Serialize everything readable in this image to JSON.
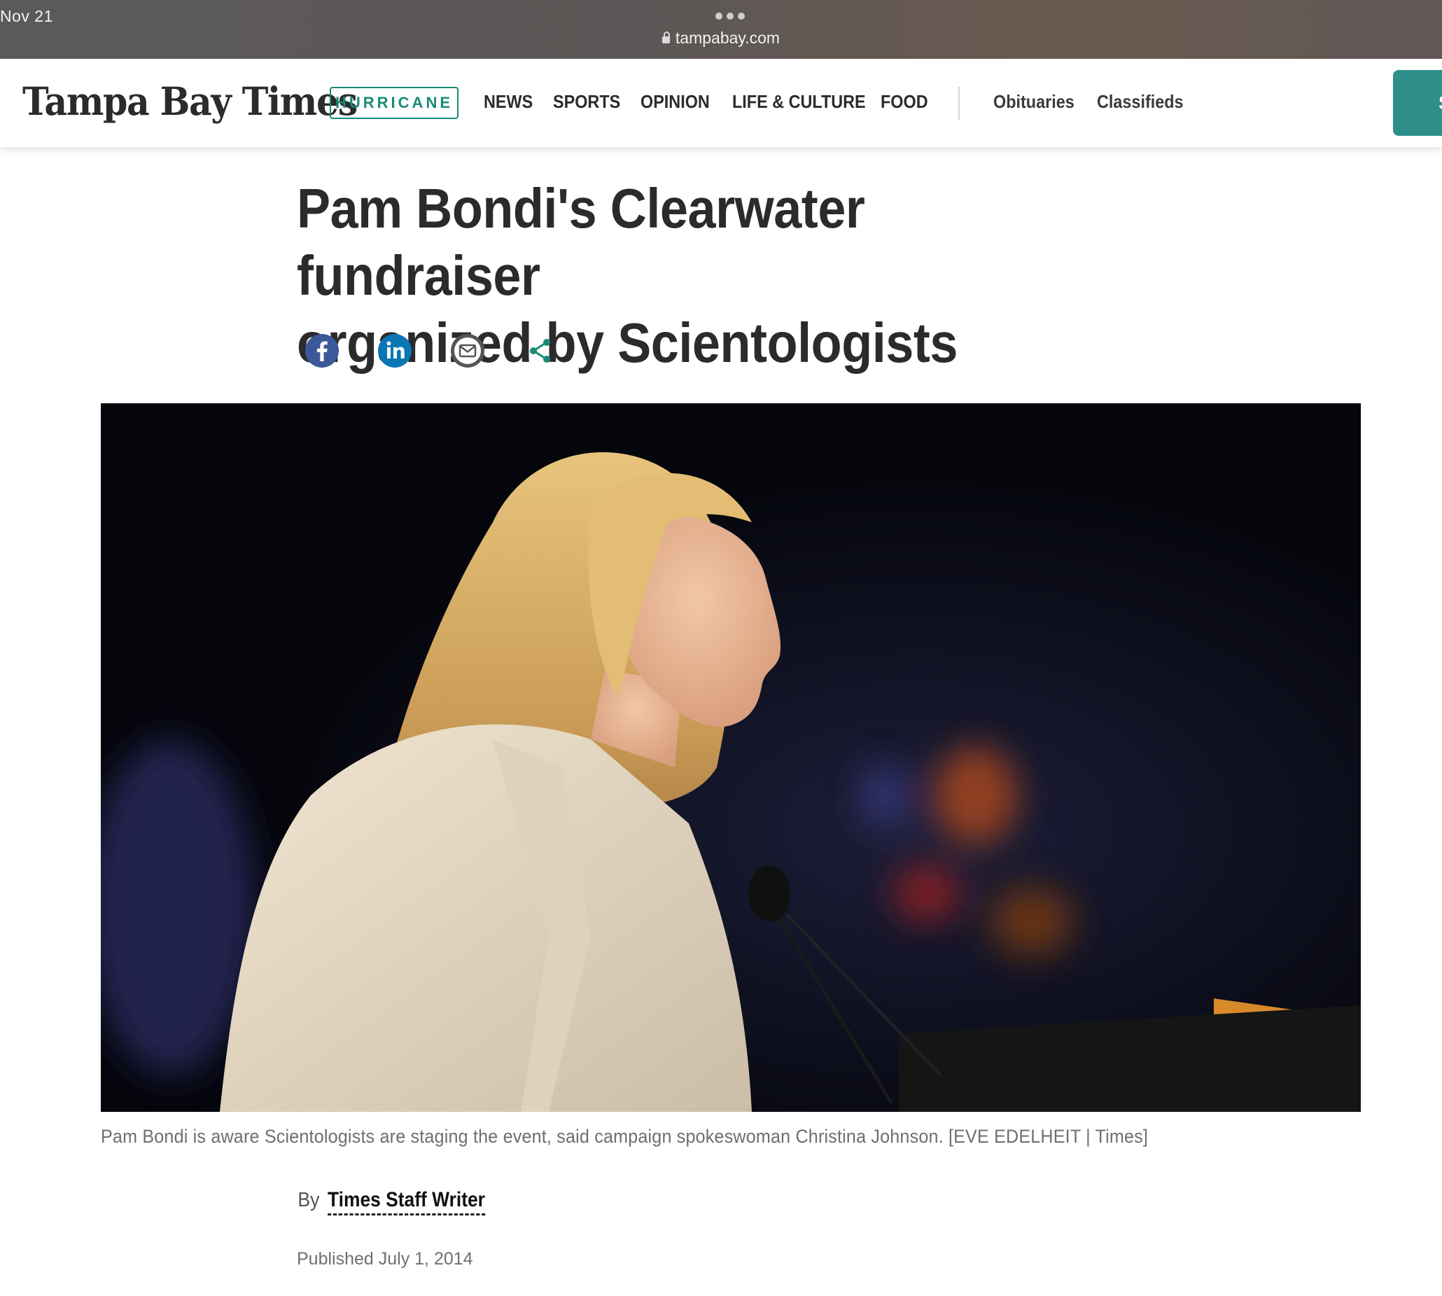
{
  "status_bar": {
    "date": "Nov 21",
    "url": "tampabay.com"
  },
  "site": {
    "logo": "Tampa Bay Times",
    "hurricane_label": "HURRICANE",
    "nav": [
      "NEWS",
      "SPORTS",
      "OPINION",
      "LIFE & CULTURE",
      "FOOD"
    ],
    "nav_secondary": [
      "Obituaries",
      "Classifieds"
    ],
    "subscribe_label": "S"
  },
  "article": {
    "headline_line1": "Pam Bondi's Clearwater fundraiser",
    "headline_line2": "organized by Scientologists",
    "share_icons": [
      "facebook-icon",
      "linkedin-icon",
      "email-icon",
      "share-icon"
    ],
    "caption": "Pam Bondi is aware Scientologists are staging the event, said campaign spokeswoman Christina Johnson. [EVE EDELHEIT | Times]",
    "byline_prefix": "By",
    "author": "Times Staff Writer",
    "published": "Published July 1, 2014"
  },
  "colors": {
    "brand_teal": "#1a8a76",
    "facebook": "#3b5998",
    "linkedin": "#0a76b4",
    "share_green": "#1a8a76"
  }
}
